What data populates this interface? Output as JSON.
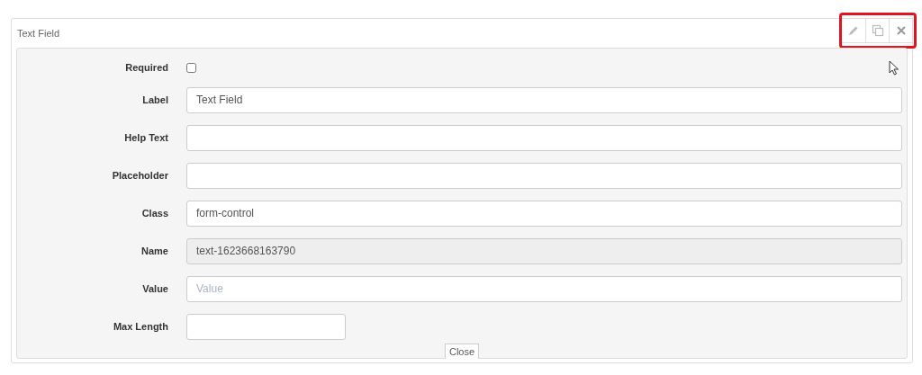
{
  "panel": {
    "title": "Text Field",
    "actions": [
      {
        "kind": "edit"
      },
      {
        "kind": "copy"
      },
      {
        "kind": "close"
      }
    ]
  },
  "fields": [
    {
      "kind": "checkbox",
      "label": "Required",
      "checked": false
    },
    {
      "kind": "text",
      "label": "Label",
      "value": "Text Field",
      "disabled": false
    },
    {
      "kind": "text",
      "label": "Help Text",
      "disabled": false
    },
    {
      "kind": "text",
      "label": "Placeholder",
      "disabled": false
    },
    {
      "kind": "text",
      "label": "Class",
      "value": "form-control",
      "disabled": false
    },
    {
      "kind": "text",
      "label": "Name",
      "value": "text-1623668163790",
      "disabled": true
    },
    {
      "kind": "text",
      "label": "Value",
      "placeholder": "Value",
      "disabled": false
    },
    {
      "kind": "short",
      "label": "Max Length",
      "disabled": false
    }
  ],
  "close_button": "Close"
}
